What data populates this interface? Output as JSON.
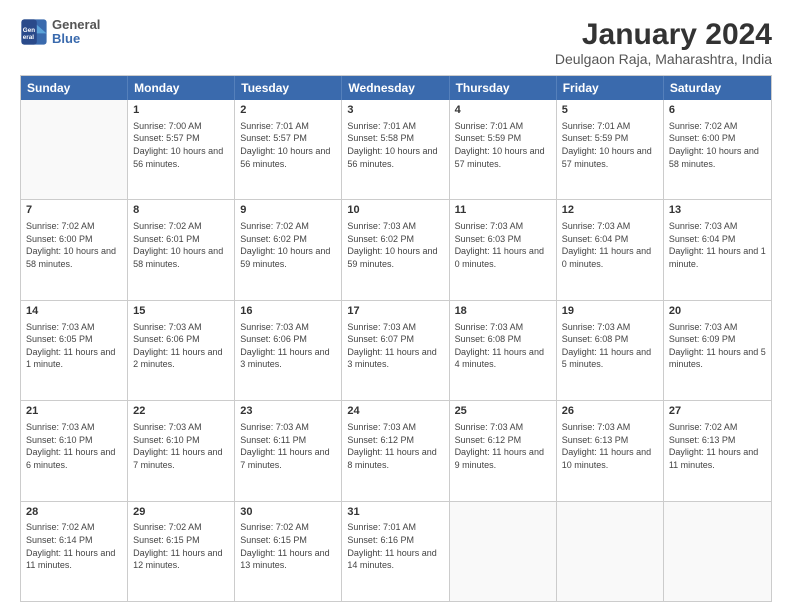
{
  "header": {
    "logo_line1": "General",
    "logo_line2": "Blue",
    "title": "January 2024",
    "subtitle": "Deulgaon Raja, Maharashtra, India"
  },
  "weekdays": [
    "Sunday",
    "Monday",
    "Tuesday",
    "Wednesday",
    "Thursday",
    "Friday",
    "Saturday"
  ],
  "weeks": [
    [
      {
        "day": "",
        "sunrise": "",
        "sunset": "",
        "daylight": ""
      },
      {
        "day": "1",
        "sunrise": "Sunrise: 7:00 AM",
        "sunset": "Sunset: 5:57 PM",
        "daylight": "Daylight: 10 hours and 56 minutes."
      },
      {
        "day": "2",
        "sunrise": "Sunrise: 7:01 AM",
        "sunset": "Sunset: 5:57 PM",
        "daylight": "Daylight: 10 hours and 56 minutes."
      },
      {
        "day": "3",
        "sunrise": "Sunrise: 7:01 AM",
        "sunset": "Sunset: 5:58 PM",
        "daylight": "Daylight: 10 hours and 56 minutes."
      },
      {
        "day": "4",
        "sunrise": "Sunrise: 7:01 AM",
        "sunset": "Sunset: 5:59 PM",
        "daylight": "Daylight: 10 hours and 57 minutes."
      },
      {
        "day": "5",
        "sunrise": "Sunrise: 7:01 AM",
        "sunset": "Sunset: 5:59 PM",
        "daylight": "Daylight: 10 hours and 57 minutes."
      },
      {
        "day": "6",
        "sunrise": "Sunrise: 7:02 AM",
        "sunset": "Sunset: 6:00 PM",
        "daylight": "Daylight: 10 hours and 58 minutes."
      }
    ],
    [
      {
        "day": "7",
        "sunrise": "Sunrise: 7:02 AM",
        "sunset": "Sunset: 6:00 PM",
        "daylight": "Daylight: 10 hours and 58 minutes."
      },
      {
        "day": "8",
        "sunrise": "Sunrise: 7:02 AM",
        "sunset": "Sunset: 6:01 PM",
        "daylight": "Daylight: 10 hours and 58 minutes."
      },
      {
        "day": "9",
        "sunrise": "Sunrise: 7:02 AM",
        "sunset": "Sunset: 6:02 PM",
        "daylight": "Daylight: 10 hours and 59 minutes."
      },
      {
        "day": "10",
        "sunrise": "Sunrise: 7:03 AM",
        "sunset": "Sunset: 6:02 PM",
        "daylight": "Daylight: 10 hours and 59 minutes."
      },
      {
        "day": "11",
        "sunrise": "Sunrise: 7:03 AM",
        "sunset": "Sunset: 6:03 PM",
        "daylight": "Daylight: 11 hours and 0 minutes."
      },
      {
        "day": "12",
        "sunrise": "Sunrise: 7:03 AM",
        "sunset": "Sunset: 6:04 PM",
        "daylight": "Daylight: 11 hours and 0 minutes."
      },
      {
        "day": "13",
        "sunrise": "Sunrise: 7:03 AM",
        "sunset": "Sunset: 6:04 PM",
        "daylight": "Daylight: 11 hours and 1 minute."
      }
    ],
    [
      {
        "day": "14",
        "sunrise": "Sunrise: 7:03 AM",
        "sunset": "Sunset: 6:05 PM",
        "daylight": "Daylight: 11 hours and 1 minute."
      },
      {
        "day": "15",
        "sunrise": "Sunrise: 7:03 AM",
        "sunset": "Sunset: 6:06 PM",
        "daylight": "Daylight: 11 hours and 2 minutes."
      },
      {
        "day": "16",
        "sunrise": "Sunrise: 7:03 AM",
        "sunset": "Sunset: 6:06 PM",
        "daylight": "Daylight: 11 hours and 3 minutes."
      },
      {
        "day": "17",
        "sunrise": "Sunrise: 7:03 AM",
        "sunset": "Sunset: 6:07 PM",
        "daylight": "Daylight: 11 hours and 3 minutes."
      },
      {
        "day": "18",
        "sunrise": "Sunrise: 7:03 AM",
        "sunset": "Sunset: 6:08 PM",
        "daylight": "Daylight: 11 hours and 4 minutes."
      },
      {
        "day": "19",
        "sunrise": "Sunrise: 7:03 AM",
        "sunset": "Sunset: 6:08 PM",
        "daylight": "Daylight: 11 hours and 5 minutes."
      },
      {
        "day": "20",
        "sunrise": "Sunrise: 7:03 AM",
        "sunset": "Sunset: 6:09 PM",
        "daylight": "Daylight: 11 hours and 5 minutes."
      }
    ],
    [
      {
        "day": "21",
        "sunrise": "Sunrise: 7:03 AM",
        "sunset": "Sunset: 6:10 PM",
        "daylight": "Daylight: 11 hours and 6 minutes."
      },
      {
        "day": "22",
        "sunrise": "Sunrise: 7:03 AM",
        "sunset": "Sunset: 6:10 PM",
        "daylight": "Daylight: 11 hours and 7 minutes."
      },
      {
        "day": "23",
        "sunrise": "Sunrise: 7:03 AM",
        "sunset": "Sunset: 6:11 PM",
        "daylight": "Daylight: 11 hours and 7 minutes."
      },
      {
        "day": "24",
        "sunrise": "Sunrise: 7:03 AM",
        "sunset": "Sunset: 6:12 PM",
        "daylight": "Daylight: 11 hours and 8 minutes."
      },
      {
        "day": "25",
        "sunrise": "Sunrise: 7:03 AM",
        "sunset": "Sunset: 6:12 PM",
        "daylight": "Daylight: 11 hours and 9 minutes."
      },
      {
        "day": "26",
        "sunrise": "Sunrise: 7:03 AM",
        "sunset": "Sunset: 6:13 PM",
        "daylight": "Daylight: 11 hours and 10 minutes."
      },
      {
        "day": "27",
        "sunrise": "Sunrise: 7:02 AM",
        "sunset": "Sunset: 6:13 PM",
        "daylight": "Daylight: 11 hours and 11 minutes."
      }
    ],
    [
      {
        "day": "28",
        "sunrise": "Sunrise: 7:02 AM",
        "sunset": "Sunset: 6:14 PM",
        "daylight": "Daylight: 11 hours and 11 minutes."
      },
      {
        "day": "29",
        "sunrise": "Sunrise: 7:02 AM",
        "sunset": "Sunset: 6:15 PM",
        "daylight": "Daylight: 11 hours and 12 minutes."
      },
      {
        "day": "30",
        "sunrise": "Sunrise: 7:02 AM",
        "sunset": "Sunset: 6:15 PM",
        "daylight": "Daylight: 11 hours and 13 minutes."
      },
      {
        "day": "31",
        "sunrise": "Sunrise: 7:01 AM",
        "sunset": "Sunset: 6:16 PM",
        "daylight": "Daylight: 11 hours and 14 minutes."
      },
      {
        "day": "",
        "sunrise": "",
        "sunset": "",
        "daylight": ""
      },
      {
        "day": "",
        "sunrise": "",
        "sunset": "",
        "daylight": ""
      },
      {
        "day": "",
        "sunrise": "",
        "sunset": "",
        "daylight": ""
      }
    ]
  ]
}
